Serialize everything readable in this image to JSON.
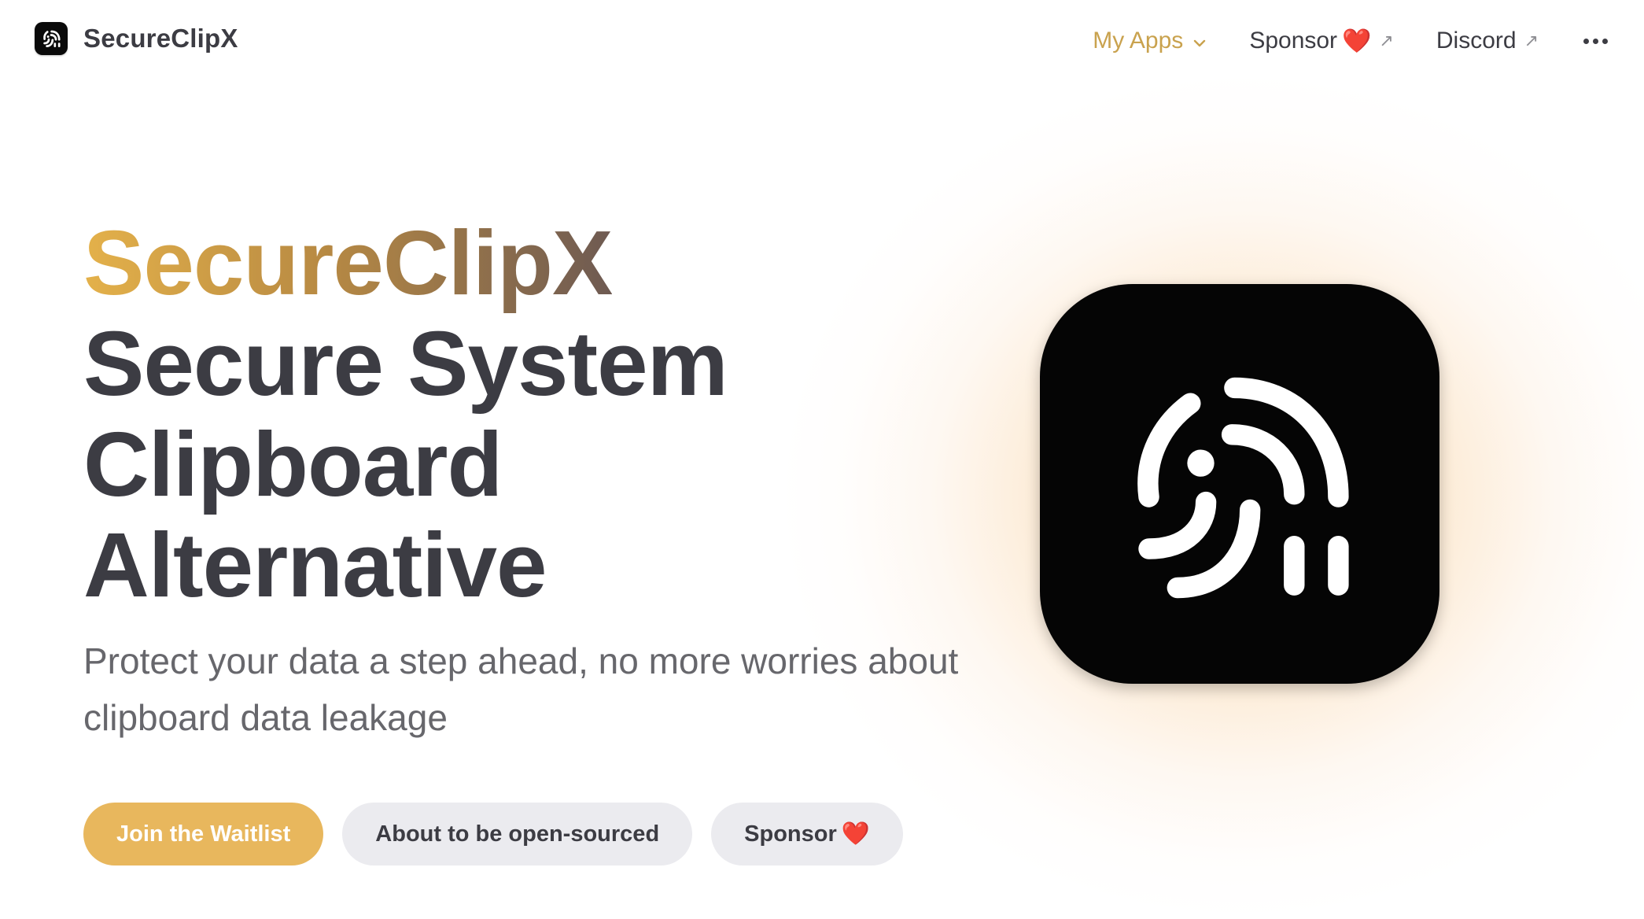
{
  "nav": {
    "brand_name": "SecureClipX",
    "links": {
      "my_apps": "My Apps",
      "sponsor": "Sponsor",
      "discord": "Discord"
    },
    "icons": {
      "heart": "❤️",
      "external": "↗"
    }
  },
  "hero": {
    "title_name": "SecureClipX",
    "title_line1": "Secure System",
    "title_line2": "Clipboard",
    "title_line3": "Alternative",
    "tagline": "Protect your data a step ahead, no more worries about clipboard data leakage"
  },
  "actions": {
    "waitlist": "Join the Waitlist",
    "open_source": "About to be open-sourced",
    "sponsor": "Sponsor"
  },
  "colors": {
    "accent": "#e8b75d",
    "active_nav": "#c9a24e",
    "text": "#3c3c43",
    "muted": "#67676c",
    "pill": "#ebebef",
    "icon_bg": "#050505"
  }
}
